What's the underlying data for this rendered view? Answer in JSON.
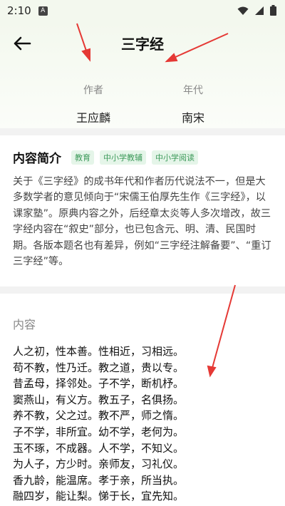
{
  "status_bar": {
    "time": "2:10",
    "badge": "A",
    "icons": [
      "wifi-icon",
      "signal-icon",
      "battery-icon"
    ]
  },
  "header": {
    "back_icon": "arrow-left-icon",
    "title": "三字经",
    "author_label": "作者",
    "author_value": "王应麟",
    "era_label": "年代",
    "era_value": "南宋"
  },
  "intro": {
    "title": "内容简介",
    "tags": [
      "教育",
      "中小学教辅",
      "中小学阅读"
    ],
    "text": "关于《三字经》的成书年代和作者历代说法不一，但是大多数学者的意见倾向于“宋儒王伯厚先生作《三字经》，以课家塾”。原典内容之外，后经章太炎等人多次增改，故三字经内容在“叙史”部分，也已包含元、明、清、民国时期。各版本题名也有差异，例如“三字经注解备要”、“重订三字经”等。"
  },
  "content": {
    "label": "内容",
    "lines": [
      "人之初，性本善。性相近，习相远。",
      "苟不教，性乃迁。教之道，贵以专。",
      "昔孟母，择邻处。子不学，断机杼。",
      "窦燕山，有义方。教五子，名俱扬。",
      "养不教，父之过。教不严，师之惰。",
      "子不学，非所宜。幼不学，老何为。",
      "玉不琢，不成器。人不学，不知义。",
      "为人子，方少时。亲师友，习礼仪。",
      "香九龄，能温席。孝于亲，所当执。",
      "融四岁，能让梨。悌于长，宜先知。"
    ]
  },
  "colors": {
    "accent": "#3d9a5a",
    "tag_bg": "#e5f5e9",
    "annotation_arrow": "#e53935"
  }
}
